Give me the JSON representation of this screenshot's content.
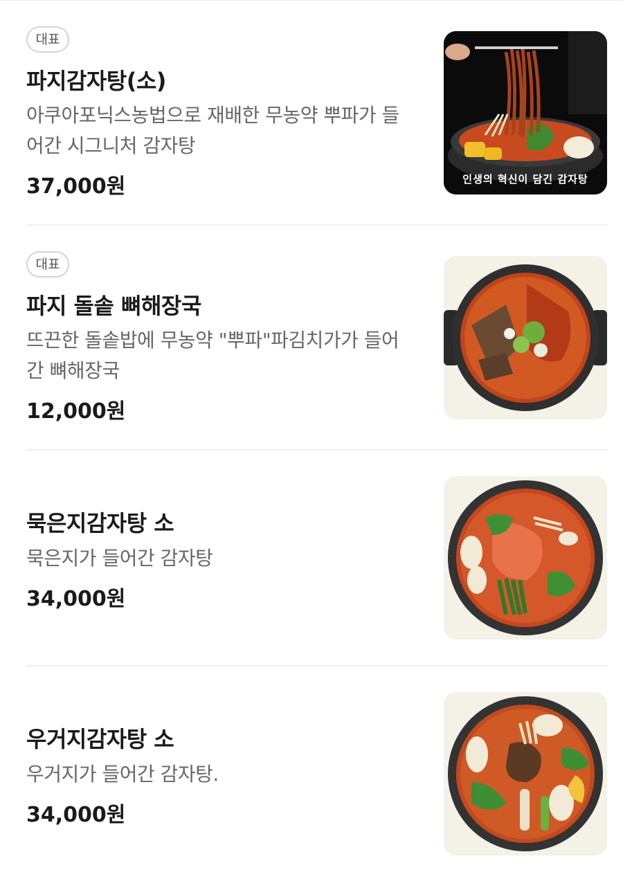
{
  "menu": {
    "items": [
      {
        "badge": "대표",
        "name": "파지감자탕(소)",
        "description": "아쿠아포닉스농법으로 재배한 무농약 뿌파가 들어간 시그니처 감자탕",
        "price": "37,000원",
        "image_caption": "인생의 혁신이 담긴 감자탕",
        "image_icon": "stew-with-noodles-photo"
      },
      {
        "badge": "대표",
        "name": "파지 돌솥 뼈해장국",
        "description": "뜨끈한 돌솥밥에 무농약 \"뿌파\"파김치가가 들어간 뼈해장국",
        "price": "12,000원",
        "image_icon": "bone-soup-pot-photo"
      },
      {
        "name": "묵은지감자탕 소",
        "description": "묵은지가 들어간 감자탕",
        "price": "34,000원",
        "image_icon": "kimchi-stew-pot-photo"
      },
      {
        "name": "우거지감자탕 소",
        "description": "우거지가 들어간 감자탕.",
        "price": "34,000원",
        "image_icon": "cabbage-stew-pot-photo"
      }
    ]
  },
  "colors": {
    "badge_border": "#d4d4d4",
    "title": "#1a1a1a",
    "description": "#666666",
    "divider": "#f0f0f0",
    "thumb_bg": "#f4f1e6"
  }
}
